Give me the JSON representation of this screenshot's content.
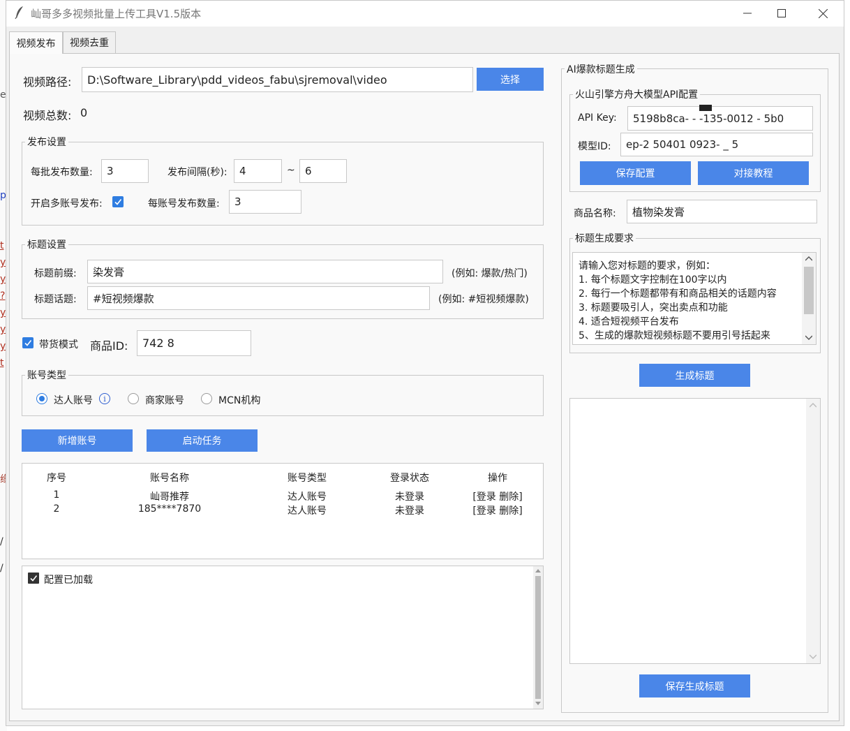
{
  "window": {
    "title": "屾哥多多视频批量上传工具V1.5版本"
  },
  "tabs": [
    {
      "label": "视频发布"
    },
    {
      "label": "视频去重"
    }
  ],
  "video": {
    "path_label": "视频路径:",
    "path_value": "D:\\Software_Library\\pdd_videos_fabu\\sjremoval\\video",
    "select_button": "选择",
    "total_label": "视频总数:",
    "total_value": "0"
  },
  "publish_settings": {
    "legend": "发布设置",
    "batch_label": "每批发布数量:",
    "batch_value": "3",
    "interval_label": "发布间隔(秒):",
    "interval_min": "4",
    "tilde": "~",
    "interval_max": "6",
    "multi_account_label": "开启多账号发布:",
    "multi_account_checked": true,
    "per_account_label": "每账号发布数量:",
    "per_account_value": "3"
  },
  "title_settings": {
    "legend": "标题设置",
    "prefix_label": "标题前缀:",
    "prefix_value": "染发膏",
    "prefix_hint": "(例如: 爆款/热门)",
    "topic_label": "标题话题:",
    "topic_value": "#短视频爆款",
    "topic_hint": "(例如: #短视频爆款)"
  },
  "goods": {
    "mode_label": "带货模式",
    "mode_checked": true,
    "id_label": "商品ID:",
    "id_value": "742           8"
  },
  "account_type": {
    "legend": "账号类型",
    "options": [
      {
        "label": "达人账号",
        "selected": true
      },
      {
        "label": "商家账号",
        "selected": false
      },
      {
        "label": "MCN机构",
        "selected": false
      }
    ],
    "info_glyph": "i"
  },
  "actions": {
    "add_account": "新增账号",
    "start_task": "启动任务"
  },
  "accounts_table": {
    "headers": [
      "序号",
      "账号名称",
      "账号类型",
      "登录状态",
      "操作"
    ],
    "rows": [
      {
        "no": "1",
        "name": "屾哥推荐",
        "type": "达人账号",
        "status": "未登录",
        "ops": "[登录 删除]"
      },
      {
        "no": "2",
        "name": "185****7870",
        "type": "达人账号",
        "status": "未登录",
        "ops": "[登录 删除]"
      }
    ]
  },
  "log": {
    "config_loaded": "配置已加载"
  },
  "ai": {
    "legend": "AI爆款标题生成",
    "api_group_legend": "火山引擎方舟大模型API配置",
    "api_key_label": "API Key:",
    "api_key_value": "5198b8ca-      -  -135-0012 -      5b0",
    "model_id_label": "模型ID:",
    "model_id_value": "ep-2      50401      0923-  _     5",
    "save_config": "保存配置",
    "tutorial": "对接教程",
    "product_label": "商品名称:",
    "product_value": "植物染发膏",
    "requirements_legend": "标题生成要求",
    "requirements_lines": [
      "请输入您对标题的要求，例如：",
      "1. 每个标题文字控制在100字以内",
      "2. 每行一个标题都带有和商品相关的话题内容",
      "3. 标题要吸引人，突出卖点和功能",
      "4. 适合短视频平台发布",
      "5、生成的爆款短视频标题不要用引号括起来"
    ],
    "generate_button": "生成标题",
    "save_generated_button": "保存生成标题"
  },
  "background": {
    "chars": [
      "e",
      "p",
      "t",
      "y",
      "y",
      "?",
      "y",
      "y",
      "y",
      "t",
      "缘",
      "/",
      "/"
    ]
  },
  "colors": {
    "accent": "#4a86e8",
    "checkbox": "#2f7de1"
  }
}
